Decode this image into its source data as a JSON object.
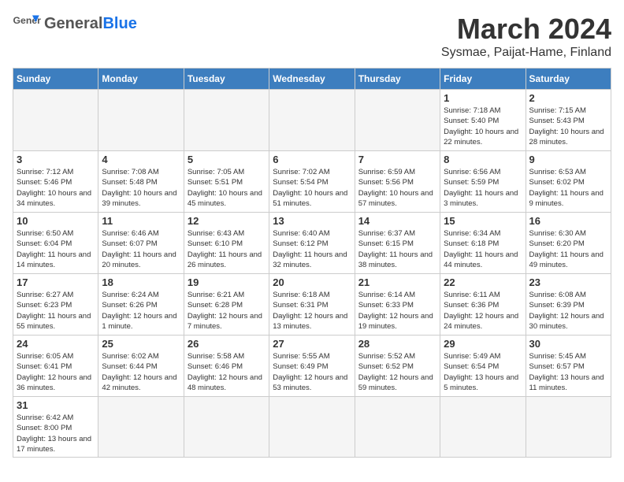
{
  "header": {
    "logo_general": "General",
    "logo_blue": "Blue",
    "month_title": "March 2024",
    "location": "Sysmae, Paijat-Hame, Finland"
  },
  "days_of_week": [
    "Sunday",
    "Monday",
    "Tuesday",
    "Wednesday",
    "Thursday",
    "Friday",
    "Saturday"
  ],
  "weeks": [
    [
      {
        "day": "",
        "info": ""
      },
      {
        "day": "",
        "info": ""
      },
      {
        "day": "",
        "info": ""
      },
      {
        "day": "",
        "info": ""
      },
      {
        "day": "",
        "info": ""
      },
      {
        "day": "1",
        "info": "Sunrise: 7:18 AM\nSunset: 5:40 PM\nDaylight: 10 hours\nand 22 minutes."
      },
      {
        "day": "2",
        "info": "Sunrise: 7:15 AM\nSunset: 5:43 PM\nDaylight: 10 hours\nand 28 minutes."
      }
    ],
    [
      {
        "day": "3",
        "info": "Sunrise: 7:12 AM\nSunset: 5:46 PM\nDaylight: 10 hours\nand 34 minutes."
      },
      {
        "day": "4",
        "info": "Sunrise: 7:08 AM\nSunset: 5:48 PM\nDaylight: 10 hours\nand 39 minutes."
      },
      {
        "day": "5",
        "info": "Sunrise: 7:05 AM\nSunset: 5:51 PM\nDaylight: 10 hours\nand 45 minutes."
      },
      {
        "day": "6",
        "info": "Sunrise: 7:02 AM\nSunset: 5:54 PM\nDaylight: 10 hours\nand 51 minutes."
      },
      {
        "day": "7",
        "info": "Sunrise: 6:59 AM\nSunset: 5:56 PM\nDaylight: 10 hours\nand 57 minutes."
      },
      {
        "day": "8",
        "info": "Sunrise: 6:56 AM\nSunset: 5:59 PM\nDaylight: 11 hours\nand 3 minutes."
      },
      {
        "day": "9",
        "info": "Sunrise: 6:53 AM\nSunset: 6:02 PM\nDaylight: 11 hours\nand 9 minutes."
      }
    ],
    [
      {
        "day": "10",
        "info": "Sunrise: 6:50 AM\nSunset: 6:04 PM\nDaylight: 11 hours\nand 14 minutes."
      },
      {
        "day": "11",
        "info": "Sunrise: 6:46 AM\nSunset: 6:07 PM\nDaylight: 11 hours\nand 20 minutes."
      },
      {
        "day": "12",
        "info": "Sunrise: 6:43 AM\nSunset: 6:10 PM\nDaylight: 11 hours\nand 26 minutes."
      },
      {
        "day": "13",
        "info": "Sunrise: 6:40 AM\nSunset: 6:12 PM\nDaylight: 11 hours\nand 32 minutes."
      },
      {
        "day": "14",
        "info": "Sunrise: 6:37 AM\nSunset: 6:15 PM\nDaylight: 11 hours\nand 38 minutes."
      },
      {
        "day": "15",
        "info": "Sunrise: 6:34 AM\nSunset: 6:18 PM\nDaylight: 11 hours\nand 44 minutes."
      },
      {
        "day": "16",
        "info": "Sunrise: 6:30 AM\nSunset: 6:20 PM\nDaylight: 11 hours\nand 49 minutes."
      }
    ],
    [
      {
        "day": "17",
        "info": "Sunrise: 6:27 AM\nSunset: 6:23 PM\nDaylight: 11 hours\nand 55 minutes."
      },
      {
        "day": "18",
        "info": "Sunrise: 6:24 AM\nSunset: 6:26 PM\nDaylight: 12 hours\nand 1 minute."
      },
      {
        "day": "19",
        "info": "Sunrise: 6:21 AM\nSunset: 6:28 PM\nDaylight: 12 hours\nand 7 minutes."
      },
      {
        "day": "20",
        "info": "Sunrise: 6:18 AM\nSunset: 6:31 PM\nDaylight: 12 hours\nand 13 minutes."
      },
      {
        "day": "21",
        "info": "Sunrise: 6:14 AM\nSunset: 6:33 PM\nDaylight: 12 hours\nand 19 minutes."
      },
      {
        "day": "22",
        "info": "Sunrise: 6:11 AM\nSunset: 6:36 PM\nDaylight: 12 hours\nand 24 minutes."
      },
      {
        "day": "23",
        "info": "Sunrise: 6:08 AM\nSunset: 6:39 PM\nDaylight: 12 hours\nand 30 minutes."
      }
    ],
    [
      {
        "day": "24",
        "info": "Sunrise: 6:05 AM\nSunset: 6:41 PM\nDaylight: 12 hours\nand 36 minutes."
      },
      {
        "day": "25",
        "info": "Sunrise: 6:02 AM\nSunset: 6:44 PM\nDaylight: 12 hours\nand 42 minutes."
      },
      {
        "day": "26",
        "info": "Sunrise: 5:58 AM\nSunset: 6:46 PM\nDaylight: 12 hours\nand 48 minutes."
      },
      {
        "day": "27",
        "info": "Sunrise: 5:55 AM\nSunset: 6:49 PM\nDaylight: 12 hours\nand 53 minutes."
      },
      {
        "day": "28",
        "info": "Sunrise: 5:52 AM\nSunset: 6:52 PM\nDaylight: 12 hours\nand 59 minutes."
      },
      {
        "day": "29",
        "info": "Sunrise: 5:49 AM\nSunset: 6:54 PM\nDaylight: 13 hours\nand 5 minutes."
      },
      {
        "day": "30",
        "info": "Sunrise: 5:45 AM\nSunset: 6:57 PM\nDaylight: 13 hours\nand 11 minutes."
      }
    ],
    [
      {
        "day": "31",
        "info": "Sunrise: 6:42 AM\nSunset: 8:00 PM\nDaylight: 13 hours\nand 17 minutes."
      },
      {
        "day": "",
        "info": ""
      },
      {
        "day": "",
        "info": ""
      },
      {
        "day": "",
        "info": ""
      },
      {
        "day": "",
        "info": ""
      },
      {
        "day": "",
        "info": ""
      },
      {
        "day": "",
        "info": ""
      }
    ]
  ]
}
